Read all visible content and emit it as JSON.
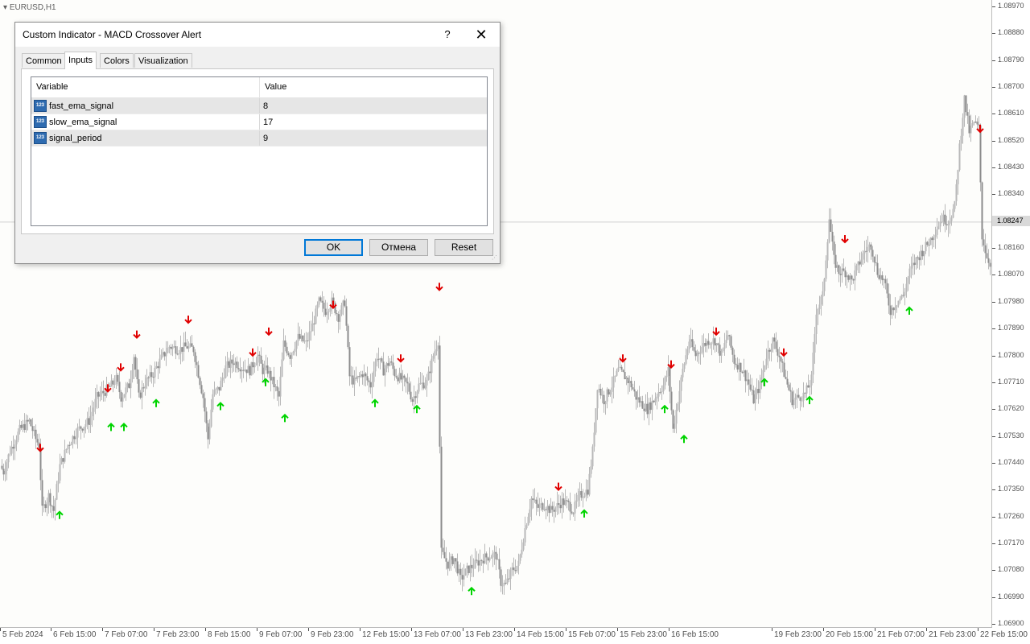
{
  "chart": {
    "symbol": "EURUSD,H1",
    "current_price": "1.08247",
    "colors": {
      "candle": "#8c8c8c",
      "candle_light": "#b8b8b8",
      "buy_arrow": "#00d400",
      "sell_arrow": "#e00000",
      "background": "#fdfdfb"
    },
    "price_scale": {
      "max": 1.0897,
      "min": 1.069
    },
    "price_ticks": [
      "1.08970",
      "1.08880",
      "1.08790",
      "1.08700",
      "1.08610",
      "1.08520",
      "1.08430",
      "1.08340",
      "1.08160",
      "1.08070",
      "1.07980",
      "1.07890",
      "1.07800",
      "1.07710",
      "1.07620",
      "1.07530",
      "1.07440",
      "1.07350",
      "1.07260",
      "1.07170",
      "1.07080",
      "1.06990",
      "1.06900"
    ],
    "time_ticks": [
      "5 Feb 2024",
      "6 Feb 15:00",
      "7 Feb 07:00",
      "7 Feb 23:00",
      "8 Feb 15:00",
      "9 Feb 07:00",
      "9 Feb 23:00",
      "12 Feb 15:00",
      "13 Feb 07:00",
      "13 Feb 23:00",
      "14 Feb 15:00",
      "15 Feb 07:00",
      "15 Feb 23:00",
      "16 Feb 15:00",
      "19 Feb 23:00",
      "20 Feb 15:00",
      "21 Feb 07:00",
      "21 Feb 23:00",
      "22 Feb 15:00"
    ],
    "trend": [
      [
        0,
        1.0743
      ],
      [
        4,
        1.0741
      ],
      [
        12,
        1.0748
      ],
      [
        24,
        1.0755
      ],
      [
        36,
        1.0758
      ],
      [
        44,
        1.0752
      ],
      [
        48,
        1.075
      ],
      [
        52,
        1.0728
      ],
      [
        60,
        1.0733
      ],
      [
        66,
        1.0728
      ],
      [
        74,
        1.0743
      ],
      [
        84,
        1.075
      ],
      [
        96,
        1.0755
      ],
      [
        110,
        1.0758
      ],
      [
        120,
        1.0766
      ],
      [
        130,
        1.0768
      ],
      [
        138,
        1.077
      ],
      [
        144,
        1.0772
      ],
      [
        150,
        1.0766
      ],
      [
        160,
        1.077
      ],
      [
        166,
        1.078
      ],
      [
        172,
        1.0766
      ],
      [
        180,
        1.0771
      ],
      [
        190,
        1.0774
      ],
      [
        200,
        1.0779
      ],
      [
        210,
        1.0783
      ],
      [
        222,
        1.0782
      ],
      [
        232,
        1.0783
      ],
      [
        240,
        1.0782
      ],
      [
        246,
        1.0774
      ],
      [
        252,
        1.0766
      ],
      [
        258,
        1.0752
      ],
      [
        264,
        1.0767
      ],
      [
        272,
        1.0769
      ],
      [
        280,
        1.0776
      ],
      [
        290,
        1.0778
      ],
      [
        300,
        1.0776
      ],
      [
        310,
        1.0775
      ],
      [
        320,
        1.078
      ],
      [
        326,
        1.0775
      ],
      [
        332,
        1.0775
      ],
      [
        340,
        1.077
      ],
      [
        346,
        1.0766
      ],
      [
        352,
        1.0784
      ],
      [
        360,
        1.078
      ],
      [
        370,
        1.0786
      ],
      [
        380,
        1.0784
      ],
      [
        388,
        1.079
      ],
      [
        396,
        1.0798
      ],
      [
        404,
        1.0795
      ],
      [
        412,
        1.0798
      ],
      [
        420,
        1.0793
      ],
      [
        428,
        1.0798
      ],
      [
        434,
        1.0773
      ],
      [
        440,
        1.0771
      ],
      [
        450,
        1.0774
      ],
      [
        460,
        1.077
      ],
      [
        468,
        1.078
      ],
      [
        476,
        1.0775
      ],
      [
        484,
        1.0778
      ],
      [
        490,
        1.0774
      ],
      [
        498,
        1.0772
      ],
      [
        506,
        1.077
      ],
      [
        512,
        1.0765
      ],
      [
        520,
        1.077
      ],
      [
        530,
        1.0771
      ],
      [
        538,
        1.078
      ],
      [
        544,
        1.0785
      ],
      [
        548,
        1.0714
      ],
      [
        556,
        1.071
      ],
      [
        564,
        1.0712
      ],
      [
        572,
        1.0705
      ],
      [
        580,
        1.0708
      ],
      [
        590,
        1.071
      ],
      [
        600,
        1.0712
      ],
      [
        610,
        1.0713
      ],
      [
        616,
        1.0713
      ],
      [
        622,
        1.0704
      ],
      [
        628,
        1.0703
      ],
      [
        636,
        1.0708
      ],
      [
        644,
        1.071
      ],
      [
        652,
        1.0722
      ],
      [
        660,
        1.0732
      ],
      [
        668,
        1.0729
      ],
      [
        676,
        1.073
      ],
      [
        684,
        1.0728
      ],
      [
        690,
        1.0729
      ],
      [
        698,
        1.0731
      ],
      [
        706,
        1.073
      ],
      [
        712,
        1.0728
      ],
      [
        720,
        1.0733
      ],
      [
        730,
        1.0735
      ],
      [
        736,
        1.0748
      ],
      [
        742,
        1.077
      ],
      [
        750,
        1.0765
      ],
      [
        760,
        1.077
      ],
      [
        768,
        1.0775
      ],
      [
        776,
        1.0773
      ],
      [
        784,
        1.077
      ],
      [
        790,
        1.0766
      ],
      [
        796,
        1.0764
      ],
      [
        804,
        1.0762
      ],
      [
        812,
        1.0765
      ],
      [
        818,
        1.0768
      ],
      [
        824,
        1.077
      ],
      [
        830,
        1.0775
      ],
      [
        836,
        1.0755
      ],
      [
        842,
        1.0765
      ],
      [
        848,
        1.0775
      ],
      [
        856,
        1.0785
      ],
      [
        864,
        1.078
      ],
      [
        872,
        1.0783
      ],
      [
        880,
        1.0785
      ],
      [
        888,
        1.0785
      ],
      [
        896,
        1.078
      ],
      [
        904,
        1.0787
      ],
      [
        912,
        1.0778
      ],
      [
        920,
        1.0776
      ],
      [
        928,
        1.0772
      ],
      [
        936,
        1.0765
      ],
      [
        944,
        1.077
      ],
      [
        952,
        1.078
      ],
      [
        960,
        1.0785
      ],
      [
        968,
        1.078
      ],
      [
        976,
        1.0772
      ],
      [
        984,
        1.0765
      ],
      [
        992,
        1.0766
      ],
      [
        1000,
        1.0767
      ],
      [
        1008,
        1.0772
      ],
      [
        1014,
        1.0795
      ],
      [
        1022,
        1.08
      ],
      [
        1030,
        1.0826
      ],
      [
        1036,
        1.0812
      ],
      [
        1042,
        1.0808
      ],
      [
        1050,
        1.0808
      ],
      [
        1058,
        1.0805
      ],
      [
        1066,
        1.081
      ],
      [
        1074,
        1.0815
      ],
      [
        1082,
        1.0817
      ],
      [
        1090,
        1.0808
      ],
      [
        1098,
        1.0805
      ],
      [
        1106,
        1.0795
      ],
      [
        1114,
        1.0798
      ],
      [
        1122,
        1.08
      ],
      [
        1130,
        1.0808
      ],
      [
        1138,
        1.0812
      ],
      [
        1146,
        1.0815
      ],
      [
        1154,
        1.0818
      ],
      [
        1162,
        1.0822
      ],
      [
        1170,
        1.0826
      ],
      [
        1178,
        1.0825
      ],
      [
        1186,
        1.083
      ],
      [
        1192,
        1.085
      ],
      [
        1198,
        1.0866
      ],
      [
        1204,
        1.0855
      ],
      [
        1210,
        1.0858
      ],
      [
        1216,
        1.0856
      ],
      [
        1220,
        1.082
      ],
      [
        1226,
        1.0813
      ],
      [
        1232,
        1.081
      ]
    ],
    "buy_signals": [
      [
        74,
        1.07265
      ],
      [
        138,
        1.0756
      ],
      [
        154,
        1.0756
      ],
      [
        194,
        1.0764
      ],
      [
        274,
        1.0763
      ],
      [
        330,
        1.0771
      ],
      [
        354,
        1.0759
      ],
      [
        466,
        1.0764
      ],
      [
        518,
        1.0762
      ],
      [
        586,
        1.0701
      ],
      [
        726,
        1.0727
      ],
      [
        826,
        1.0762
      ],
      [
        850,
        1.0752
      ],
      [
        950,
        1.0771
      ],
      [
        1006,
        1.0765
      ],
      [
        1130,
        1.0795
      ]
    ],
    "sell_signals": [
      [
        50,
        1.0749
      ],
      [
        134,
        1.0769
      ],
      [
        150,
        1.0776
      ],
      [
        170,
        1.0787
      ],
      [
        234,
        1.0792
      ],
      [
        314,
        1.0781
      ],
      [
        334,
        1.0788
      ],
      [
        414,
        1.0797
      ],
      [
        498,
        1.0779
      ],
      [
        546,
        1.0803
      ],
      [
        694,
        1.0736
      ],
      [
        774,
        1.0779
      ],
      [
        834,
        1.0777
      ],
      [
        890,
        1.0788
      ],
      [
        974,
        1.0781
      ],
      [
        1050,
        1.0819
      ],
      [
        1218,
        1.0856
      ]
    ]
  },
  "dialog": {
    "title": "Custom Indicator - MACD Crossover Alert",
    "help": "?",
    "close": "✕",
    "tabs": [
      "Common",
      "Inputs",
      "Colors",
      "Visualization"
    ],
    "active_tab": "Inputs",
    "table": {
      "headers": [
        "Variable",
        "Value"
      ],
      "rows": [
        {
          "variable": "fast_ema_signal",
          "value": "8",
          "type_icon": "int-icon"
        },
        {
          "variable": "slow_ema_signal",
          "value": "17",
          "type_icon": "int-icon"
        },
        {
          "variable": "signal_period",
          "value": "9",
          "type_icon": "int-icon"
        }
      ],
      "icon_text": "123"
    },
    "buttons": {
      "ok": "OK",
      "cancel": "Отмена",
      "reset": "Reset"
    }
  }
}
